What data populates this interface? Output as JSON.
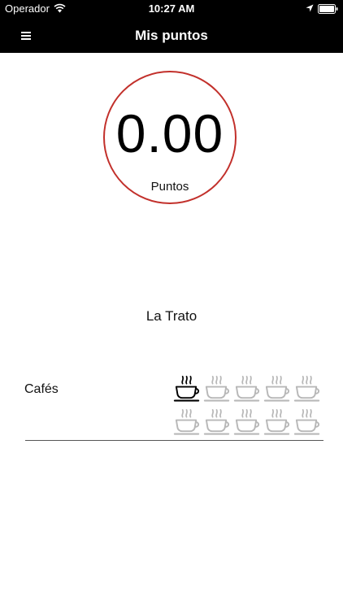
{
  "status_bar": {
    "carrier": "Operador",
    "time": "10:27 AM"
  },
  "nav": {
    "title": "Mis puntos"
  },
  "points": {
    "value": "0.00",
    "label": "Puntos",
    "ring_color": "#c2302b"
  },
  "store": {
    "name": "La Trato"
  },
  "coffee_card": {
    "label": "Cafés",
    "stamps_total": 10,
    "stamps_filled": 1,
    "filled_color": "#000000",
    "empty_color": "#b8b8b8"
  }
}
